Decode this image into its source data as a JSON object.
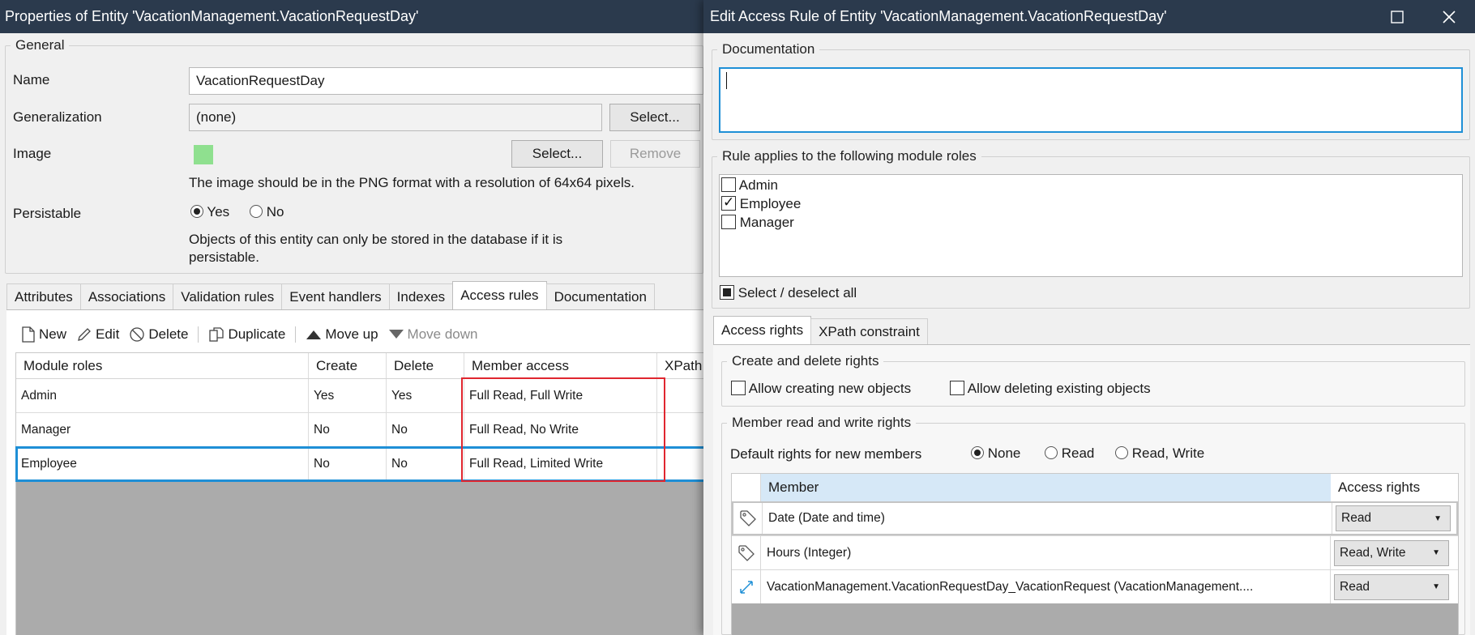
{
  "left": {
    "title": "Properties of Entity 'VacationManagement.VacationRequestDay'",
    "general": {
      "legend": "General",
      "name_label": "Name",
      "name_value": "VacationRequestDay",
      "generalization_label": "Generalization",
      "generalization_value": "(none)",
      "select_label": "Select...",
      "image_label": "Image",
      "image_select_label": "Select...",
      "remove_label": "Remove",
      "image_hint": "The image should be in the PNG format with a resolution of 64x64 pixels.",
      "persistable_label": "Persistable",
      "yes_label": "Yes",
      "no_label": "No",
      "persist_hint_1": "Objects of this entity can only be stored in the database if it is",
      "persist_hint_2": "persistable."
    },
    "tabs": [
      "Attributes",
      "Associations",
      "Validation rules",
      "Event handlers",
      "Indexes",
      "Access rules",
      "Documentation"
    ],
    "active_tab": "Access rules",
    "toolbar": {
      "new": "New",
      "edit": "Edit",
      "delete": "Delete",
      "duplicate": "Duplicate",
      "move_up": "Move up",
      "move_down": "Move down"
    },
    "grid": {
      "headers": [
        "Module roles",
        "Create",
        "Delete",
        "Member access",
        "XPath"
      ],
      "rows": [
        {
          "role": "Admin",
          "create": "Yes",
          "delete": "Yes",
          "member": "Full Read, Full Write",
          "xpath": ""
        },
        {
          "role": "Manager",
          "create": "No",
          "delete": "No",
          "member": "Full Read, No Write",
          "xpath": ""
        },
        {
          "role": "Employee",
          "create": "No",
          "delete": "No",
          "member": "Full Read, Limited Write",
          "xpath": ""
        }
      ]
    }
  },
  "right": {
    "title": "Edit Access Rule of Entity 'VacationManagement.VacationRequestDay'",
    "documentation_legend": "Documentation",
    "documentation_value": "",
    "roles_legend": "Rule applies to the following module roles",
    "roles": [
      {
        "label": "Admin",
        "checked": false
      },
      {
        "label": "Employee",
        "checked": true
      },
      {
        "label": "Manager",
        "checked": false
      }
    ],
    "select_all_label": "Select / deselect all",
    "tabs": [
      "Access rights",
      "XPath constraint"
    ],
    "create_delete_legend": "Create and delete rights",
    "allow_create_label": "Allow creating new objects",
    "allow_delete_label": "Allow deleting existing objects",
    "member_rights_legend": "Member read and write rights",
    "default_rights_label": "Default rights for new members",
    "default_options": [
      "None",
      "Read",
      "Read, Write"
    ],
    "default_selected": "None",
    "member_headers": [
      "Member",
      "Access rights"
    ],
    "members": [
      {
        "icon": "tag-icon",
        "name": "Date (Date and time)",
        "rights": "Read"
      },
      {
        "icon": "tag-icon",
        "name": "Hours (Integer)",
        "rights": "Read, Write"
      },
      {
        "icon": "association-icon",
        "name": "VacationManagement.VacationRequestDay_VacationRequest (VacationManagement....",
        "rights": "Read"
      }
    ]
  },
  "colors": {
    "titlebar": "#2b3a4d",
    "selection": "#1e8fd6",
    "highlight_box": "#e0262f",
    "image_swatch": "#8fe08f",
    "member_header": "#d6e8f7"
  }
}
